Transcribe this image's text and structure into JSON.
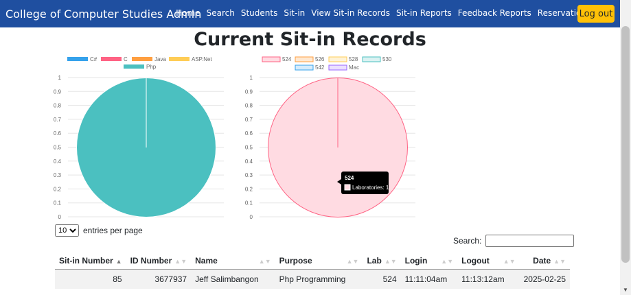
{
  "app": {
    "brand": "College of Computer Studies Admin",
    "nav": [
      "Home",
      "Search",
      "Students",
      "Sit-in",
      "View Sit-in Records",
      "Sit-in Reports",
      "Feedback Reports",
      "Reservation"
    ],
    "logout": "Log out"
  },
  "page": {
    "title": "Current Sit-in Records"
  },
  "chart_data": [
    {
      "type": "pie",
      "categories": [
        "C#",
        "C",
        "Java",
        "ASP.Net",
        "Php"
      ],
      "values": [
        0,
        0,
        0,
        0,
        1
      ],
      "colors": [
        "#36a2eb",
        "#ff6384",
        "#ff9f40",
        "#ffcd56",
        "#4bc0c0"
      ],
      "yticks": [
        "1",
        "0.9",
        "0.8",
        "0.7",
        "0.6",
        "0.5",
        "0.4",
        "0.3",
        "0.2",
        "0.1",
        "0"
      ],
      "ylim": [
        0,
        1
      ],
      "grid": true,
      "legend": "top"
    },
    {
      "type": "pie",
      "categories": [
        "524",
        "526",
        "528",
        "530",
        "542",
        "Mac"
      ],
      "values": [
        1,
        0,
        0,
        0,
        0,
        0
      ],
      "colors": [
        "#ff6384",
        "#ff9f40",
        "#ffcd56",
        "#4bc0c0",
        "#36a2eb",
        "#9966ff"
      ],
      "fills": [
        "#ffdbe2",
        "#ffe8d1",
        "#fff3d6",
        "#dbf2f2",
        "#d7ecfb",
        "#ebe0ff"
      ],
      "yticks": [
        "1",
        "0.9",
        "0.8",
        "0.7",
        "0.6",
        "0.5",
        "0.4",
        "0.3",
        "0.2",
        "0.1",
        "0"
      ],
      "ylim": [
        0,
        1
      ],
      "grid": true,
      "legend": "top",
      "tooltip": {
        "title": "524",
        "label": "Laboratories: 1"
      }
    }
  ],
  "table": {
    "length_value": "10",
    "length_label": "entries per page",
    "search_label": "Search:",
    "search_value": "",
    "columns": [
      "Sit-in Number",
      "ID Number",
      "Name",
      "Purpose",
      "Lab",
      "Login",
      "Logout",
      "Date"
    ],
    "rows": [
      [
        "85",
        "3677937",
        "Jeff Salimbangon",
        "Php Programming",
        "524",
        "11:11:04am",
        "11:13:12am",
        "2025-02-25"
      ]
    ]
  }
}
